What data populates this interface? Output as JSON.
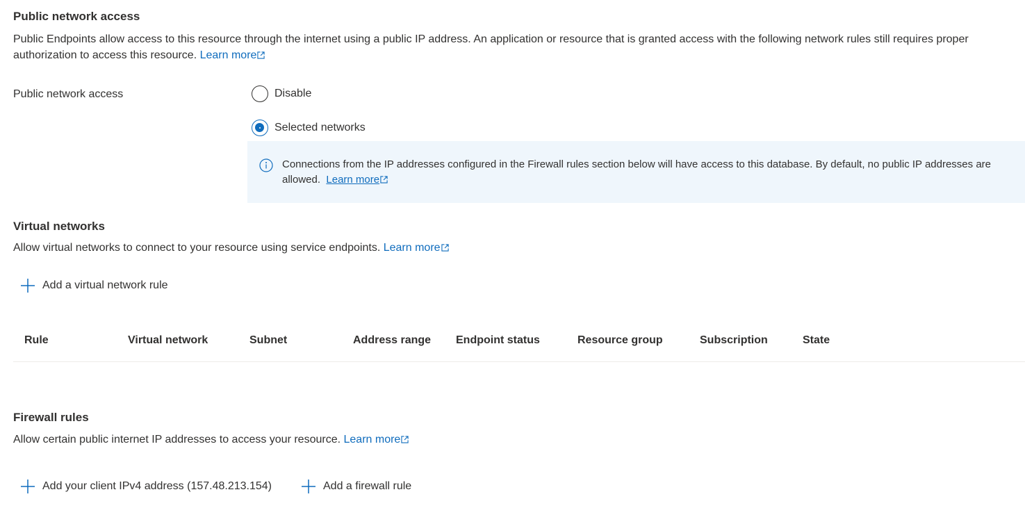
{
  "public_access": {
    "title": "Public network access",
    "description": "Public Endpoints allow access to this resource through the internet using a public IP address. An application or resource that is granted access with the following network rules still requires proper authorization to access this resource.",
    "learn_more": "Learn more",
    "field_label": "Public network access",
    "options": [
      {
        "label": "Disable",
        "selected": false
      },
      {
        "label": "Selected networks",
        "selected": true
      }
    ],
    "info": {
      "text": "Connections from the IP addresses configured in the Firewall rules section below will have access to this database. By default, no public IP addresses are allowed.",
      "learn_more": "Learn more"
    }
  },
  "virtual_networks": {
    "title": "Virtual networks",
    "description": "Allow virtual networks to connect to your resource using service endpoints.",
    "learn_more": "Learn more",
    "add_label": "Add a virtual network rule",
    "columns": [
      "Rule",
      "Virtual network",
      "Subnet",
      "Address range",
      "Endpoint status",
      "Resource group",
      "Subscription",
      "State"
    ],
    "rows": []
  },
  "firewall": {
    "title": "Firewall rules",
    "description": "Allow certain public internet IP addresses to access your resource.",
    "learn_more": "Learn more",
    "add_client_label": "Add your client IPv4 address (157.48.213.154)",
    "add_rule_label": "Add a firewall rule"
  },
  "colors": {
    "accent": "#0f6cbd",
    "info_bg": "#eff6fc",
    "text": "#323130"
  }
}
